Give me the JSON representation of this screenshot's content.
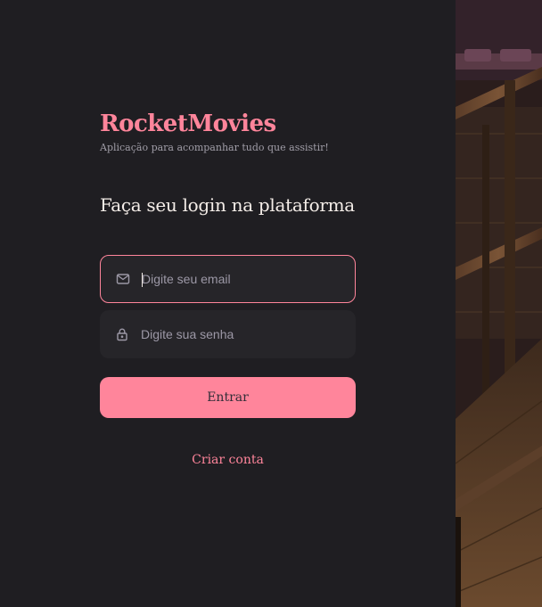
{
  "brand": {
    "name": "RocketMovies",
    "tagline": "Aplicação para acompanhar tudo que assistir!"
  },
  "login": {
    "heading": "Faça seu login na plataforma",
    "email_icon": "mail-icon",
    "password_icon": "lock-icon",
    "email_placeholder": "Digite seu email",
    "email_value": "",
    "password_placeholder": "Digite sua senha",
    "password_value": "",
    "submit_label": "Entrar",
    "create_account_label": "Criar conta"
  },
  "background": {
    "description_icon": "cinema-seats-photo"
  },
  "colors": {
    "accent": "#ff859b",
    "panel": "#1f1e22",
    "field": "#262529",
    "heading": "#f4ede8",
    "muted": "#9c98a6"
  }
}
